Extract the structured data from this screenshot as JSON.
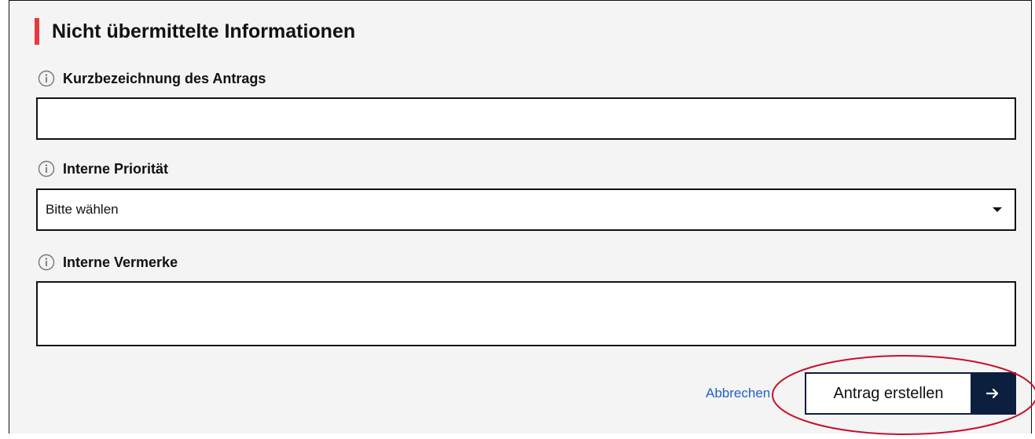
{
  "section": {
    "title": "Nicht übermittelte Informationen",
    "accent_color": "#e8383d"
  },
  "fields": {
    "short_name": {
      "label": "Kurzbezeichnung des Antrags",
      "value": "",
      "icon": "info-icon"
    },
    "priority": {
      "label": "Interne Priorität",
      "selected": "Bitte wählen",
      "icon": "info-icon"
    },
    "notes": {
      "label": "Interne Vermerke",
      "value": "",
      "icon": "info-icon"
    }
  },
  "actions": {
    "cancel_label": "Abbrechen",
    "submit_label": "Antrag erstellen",
    "submit_icon": "arrow-right-icon",
    "link_color": "#1f5fcc",
    "button_color": "#0c1f3f"
  },
  "annotation": {
    "color": "#c8102e",
    "shape": "ellipse"
  }
}
